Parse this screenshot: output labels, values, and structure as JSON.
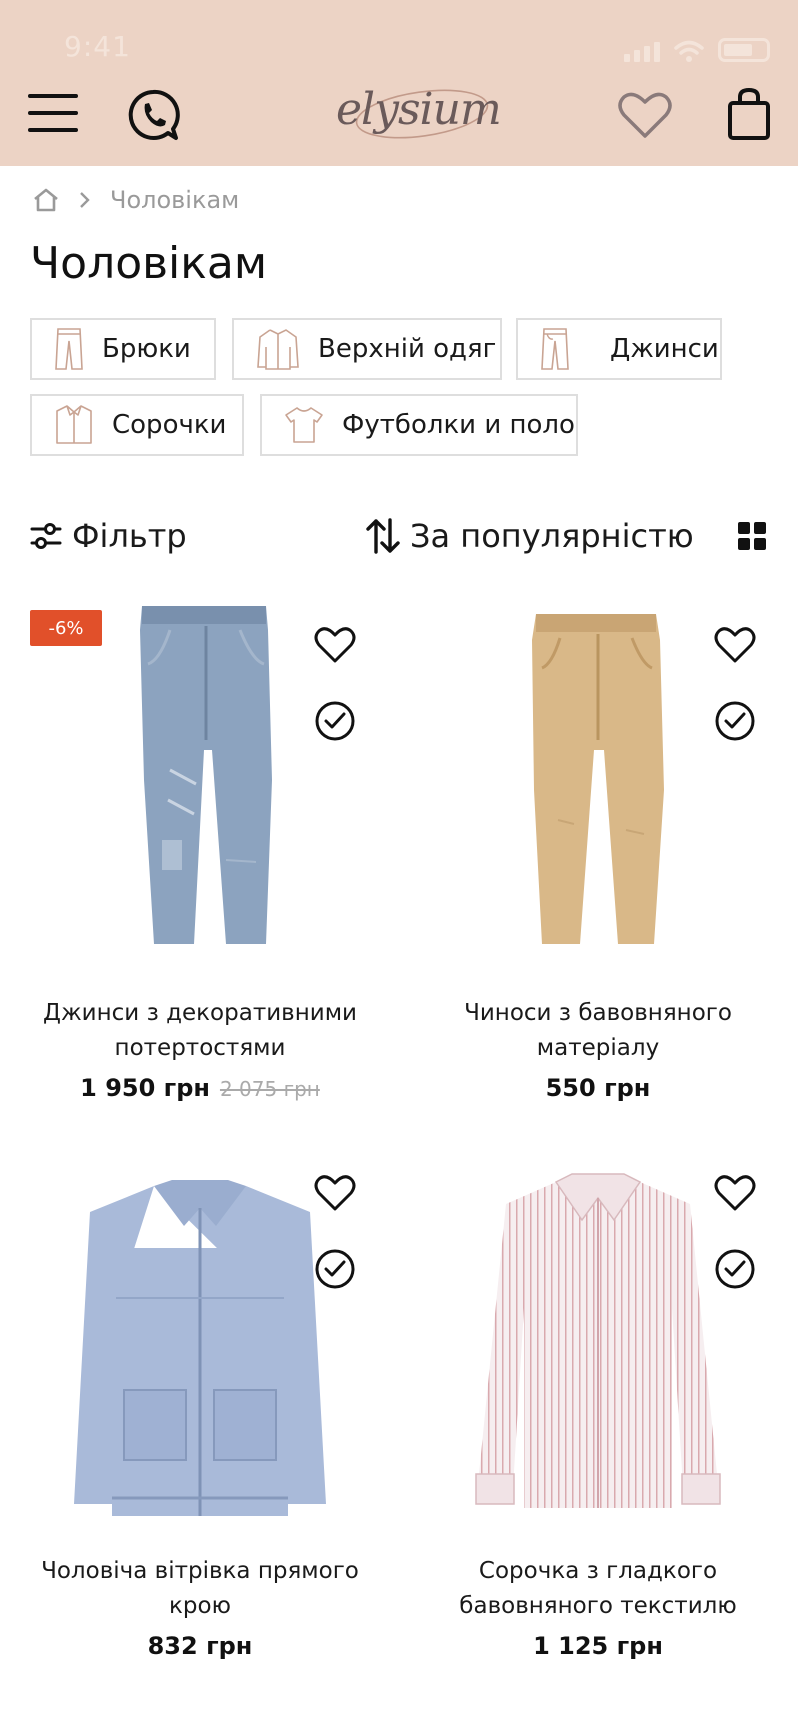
{
  "status_bar": {
    "time": "9:41"
  },
  "header": {
    "logo_text": "elysium"
  },
  "breadcrumb": {
    "current": "Чоловікам"
  },
  "page_title": "Чоловікам",
  "categories": [
    {
      "label": "Брюки",
      "icon": "trousers-icon"
    },
    {
      "label": "Верхній одяг",
      "icon": "jacket-icon"
    },
    {
      "label": "Джинси",
      "icon": "jeans-icon"
    },
    {
      "label": "Сорочки",
      "icon": "shirt-icon"
    },
    {
      "label": "Футболки и поло",
      "icon": "tshirt-icon"
    }
  ],
  "toolbar": {
    "filter_label": "Фільтр",
    "sort_label": "За популярністю"
  },
  "products": [
    {
      "name_line1": "Джинси з декоративними",
      "name_line2": "потертостями",
      "price": "1 950 грн",
      "old_price": "2 075 грн",
      "badge": "-6%"
    },
    {
      "name_line1": "Чиноси з бавовняного",
      "name_line2": "матеріалу",
      "price": "550 грн"
    },
    {
      "name_line1": "Чоловіча вітрівка прямого",
      "name_line2": "крою",
      "price": "832 грн"
    },
    {
      "name_line1": "Сорочка з гладкого",
      "name_line2": "бавовняного текстилю",
      "price": "1 125 грн"
    }
  ],
  "colors": {
    "header_bg": "#ecd3c5",
    "badge_bg": "#e1502a",
    "chip_icon": "#c9a493"
  }
}
